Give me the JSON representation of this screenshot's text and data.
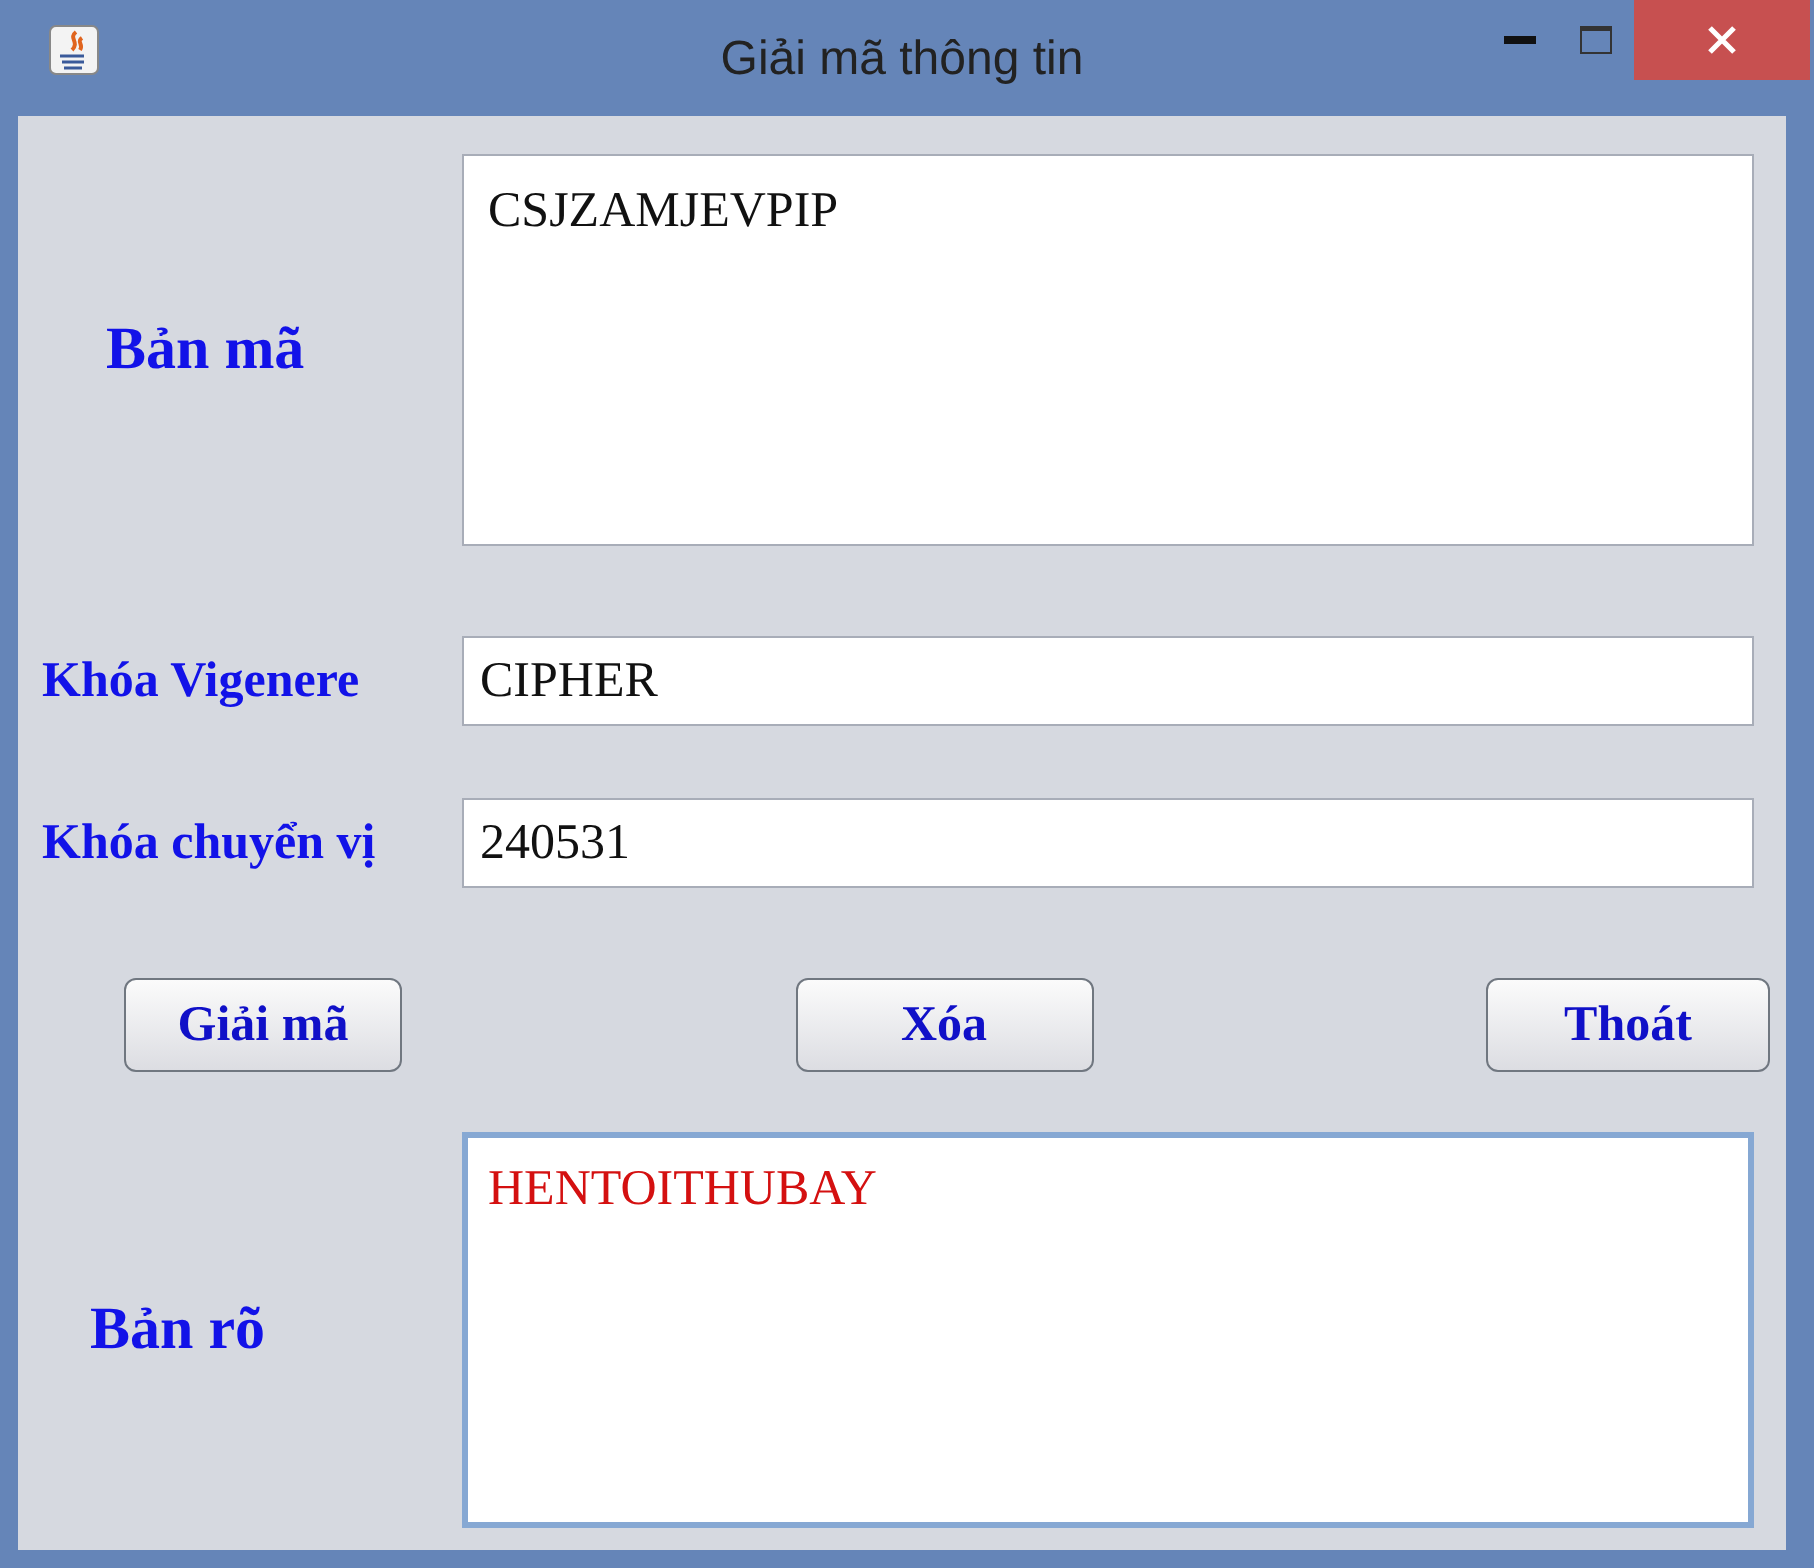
{
  "window": {
    "title": "Giải mã thông tin"
  },
  "ciphertext": {
    "label": "Bản mã",
    "value": "CSJZAMJEVPIP",
    "focused": false
  },
  "vigenere_key": {
    "label": "Khóa Vigenere",
    "value": "CIPHER"
  },
  "transposition_key": {
    "label": "Khóa chuyển vị",
    "value": "240531"
  },
  "buttons": [
    "Giải mã",
    "Xóa",
    "Thoát"
  ],
  "plaintext": {
    "label": "Bản rõ",
    "value": "HENTOITHUBAY",
    "focused": true
  }
}
